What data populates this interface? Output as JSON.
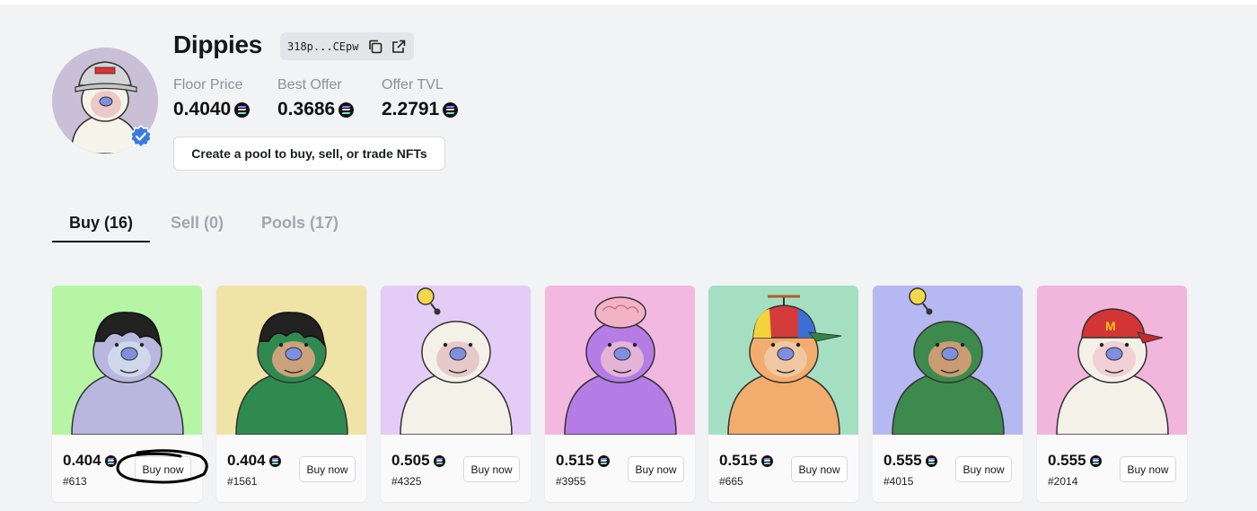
{
  "collection": {
    "name": "Dippies",
    "address": "318p...CEpw",
    "avatar_bg": "#c9bfd6",
    "verified_color": "#3b7be0"
  },
  "stats": [
    {
      "label": "Floor Price",
      "value": "0.4040"
    },
    {
      "label": "Best Offer",
      "value": "0.3686"
    },
    {
      "label": "Offer TVL",
      "value": "2.2791"
    }
  ],
  "create_pool_label": "Create a pool to buy, sell, or trade NFTs",
  "tabs": [
    {
      "label": "Buy (16)",
      "active": true
    },
    {
      "label": "Sell (0)",
      "active": false
    },
    {
      "label": "Pools (17)",
      "active": false
    }
  ],
  "cards": [
    {
      "price": "0.404",
      "id": "#613",
      "buy_label": "Buy now",
      "bg": "#b6f5a4",
      "fur": "#b9b7e0",
      "face": "#cfd8ea",
      "hair": "black"
    },
    {
      "price": "0.404",
      "id": "#1561",
      "buy_label": "Buy now",
      "bg": "#f0e3a6",
      "fur": "#2f8a4f",
      "face": "#caa27c",
      "hair": "black"
    },
    {
      "price": "0.505",
      "id": "#4325",
      "buy_label": "Buy now",
      "bg": "#e3cdf7",
      "fur": "#f4f1e8",
      "face": "#e8c9c9",
      "hair": "bulb"
    },
    {
      "price": "0.515",
      "id": "#3955",
      "buy_label": "Buy now",
      "bg": "#f2b8e0",
      "fur": "#b57ce6",
      "face": "#e3b3d8",
      "hair": "brain"
    },
    {
      "price": "0.515",
      "id": "#665",
      "buy_label": "Buy now",
      "bg": "#a5dfc2",
      "fur": "#f2ac6e",
      "face": "#efc7a1",
      "hair": "cap-rainbow"
    },
    {
      "price": "0.555",
      "id": "#4015",
      "buy_label": "Buy now",
      "bg": "#b6b8f2",
      "fur": "#3d8a4d",
      "face": "#c99c73",
      "hair": "bulb"
    },
    {
      "price": "0.555",
      "id": "#2014",
      "buy_label": "Buy now",
      "bg": "#f2b5dc",
      "fur": "#f4f1e8",
      "face": "#f1d0d6",
      "hair": "cap-red"
    }
  ]
}
